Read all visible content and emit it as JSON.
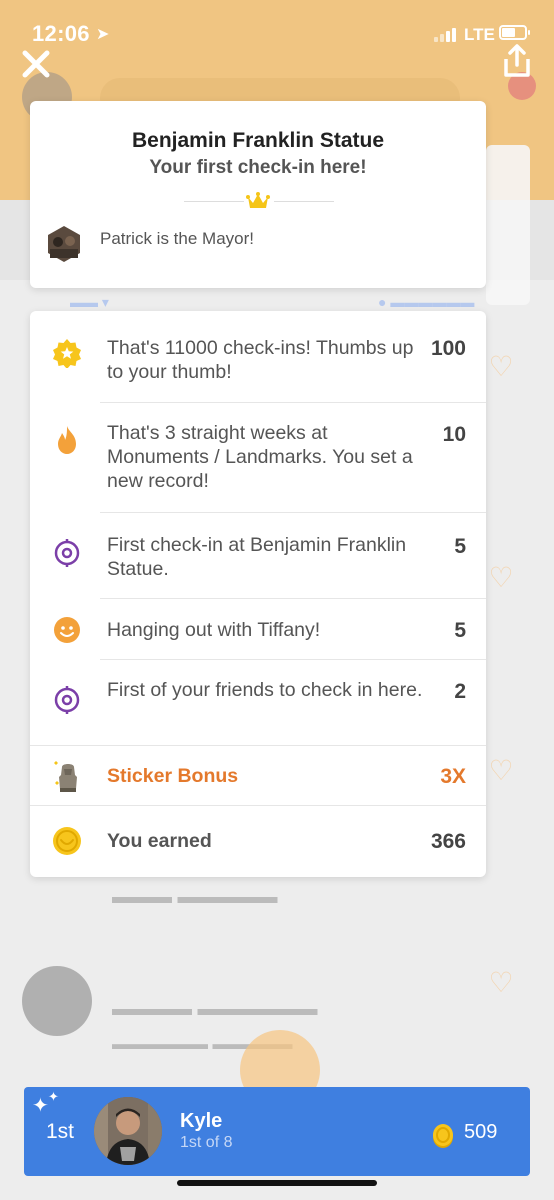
{
  "status_bar": {
    "time": "12:06",
    "network": "LTE"
  },
  "venue_card": {
    "title": "Benjamin Franklin Statue",
    "subtitle": "Your first check-in here!",
    "mayor_text": "Patrick is the Mayor!"
  },
  "points": {
    "rows": [
      {
        "icon": "star-badge-icon",
        "label": "That's 11000 check-ins! Thumbs up to your thumb!",
        "points": "100"
      },
      {
        "icon": "flame-icon",
        "label": "That's 3 straight weeks at Monuments / Landmarks. You set a new record!",
        "points": "10"
      },
      {
        "icon": "location-pin-icon",
        "label": "First check-in at Benjamin Franklin Statue.",
        "points": "5"
      },
      {
        "icon": "friend-face-icon",
        "label": "Hanging out with Tiffany!",
        "points": "5"
      },
      {
        "icon": "location-pin-icon",
        "label": "First of your friends to check in here.",
        "points": "2"
      }
    ],
    "bonus": {
      "icon": "statue-sticker-icon",
      "label": "Sticker Bonus",
      "value": "3X"
    },
    "total": {
      "icon": "coin-icon",
      "label": "You earned",
      "value": "366"
    }
  },
  "leaderboard": {
    "rank": "1st",
    "name": "Kyle",
    "rank_detail": "1st of 8",
    "coins": "509"
  },
  "colors": {
    "header_orange": "#e9a640",
    "bonus_orange": "#e4792c",
    "leader_blue": "#3f7fe0",
    "pin_purple": "#7b3fa8"
  }
}
